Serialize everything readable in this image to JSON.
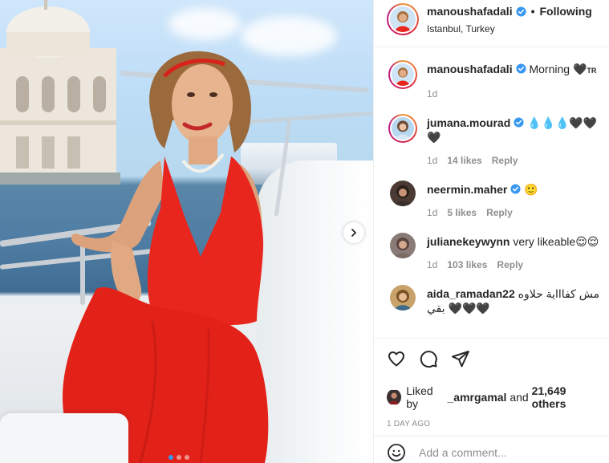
{
  "post": {
    "author": {
      "username": "manoushafadali",
      "verified": true,
      "following_label": "Following",
      "separator": "•",
      "location": "Istanbul, Turkey"
    },
    "caption": {
      "username": "manoushafadali",
      "text": "Morning 🖤",
      "suffix": "TR",
      "time": "1d"
    },
    "carousel": {
      "total": 3,
      "current": 1
    }
  },
  "comments": [
    {
      "username": "jumana.mourad",
      "verified": true,
      "text": "💧💧💧🖤🖤🖤",
      "time": "1d",
      "likes": "14 likes",
      "reply_label": "Reply"
    },
    {
      "username": "neermin.maher",
      "verified": true,
      "text": "🙂",
      "time": "1d",
      "likes": "5 likes",
      "reply_label": "Reply"
    },
    {
      "username": "julianekeywynn",
      "verified": false,
      "text": "very likeable😌😌",
      "time": "1d",
      "likes": "103 likes",
      "reply_label": "Reply"
    },
    {
      "username": "aida_ramadan22",
      "verified": false,
      "text": "مش كفاااية حلاوه بقي 🖤🖤🖤"
    }
  ],
  "actions": {
    "liked_by_prefix": "Liked by",
    "liked_by_user": "_amrgamal",
    "liked_by_and": "and",
    "liked_by_others": "21,649 others",
    "timestamp": "1 DAY AGO"
  },
  "add_comment": {
    "placeholder": "Add a comment..."
  },
  "colors": {
    "verified_blue": "#3897f0",
    "dress_red": "#e8261d",
    "muted_text": "#8e8e8e",
    "border": "#efefef"
  },
  "icons": {
    "like": "heart-icon",
    "comment": "comment-bubble-icon",
    "share": "paper-plane-icon",
    "emoji": "smiley-icon",
    "next": "chevron-right-icon",
    "verified": "verified-badge-icon"
  }
}
